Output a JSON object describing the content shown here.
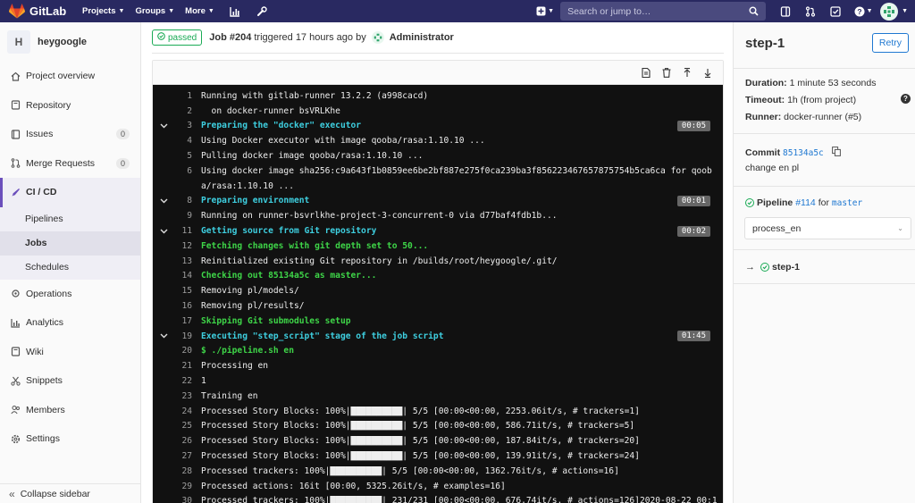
{
  "topbar": {
    "brand": "GitLab",
    "nav": [
      "Projects",
      "Groups",
      "More"
    ],
    "search_placeholder": "Search or jump to…"
  },
  "sidebar": {
    "project_initial": "H",
    "project_name": "heygoogle",
    "items": [
      {
        "label": "Project overview",
        "icon": "home-icon"
      },
      {
        "label": "Repository",
        "icon": "book-icon"
      },
      {
        "label": "Issues",
        "icon": "issues-icon",
        "count": "0"
      },
      {
        "label": "Merge Requests",
        "icon": "merge-request-icon",
        "count": "0"
      }
    ],
    "cicd": {
      "label": "CI / CD",
      "subitems": [
        "Pipelines",
        "Jobs",
        "Schedules"
      ]
    },
    "items_after": [
      {
        "label": "Operations",
        "icon": "cloud-gear-icon"
      },
      {
        "label": "Analytics",
        "icon": "chart-icon"
      },
      {
        "label": "Wiki",
        "icon": "book-icon"
      },
      {
        "label": "Snippets",
        "icon": "scissors-icon"
      },
      {
        "label": "Members",
        "icon": "users-icon"
      },
      {
        "label": "Settings",
        "icon": "gear-icon"
      }
    ],
    "collapse_label": "Collapse sidebar"
  },
  "job": {
    "status": "passed",
    "title": "Job #204",
    "triggered": "triggered 17 hours ago by",
    "user": "Administrator"
  },
  "log": [
    {
      "n": "1",
      "text": "Running with gitlab-runner 13.2.2 (a998cacd)"
    },
    {
      "n": "2",
      "text": "  on docker-runner bsVRLKhe"
    },
    {
      "n": "3",
      "text": "Preparing the \"docker\" executor",
      "type": "hd",
      "time": "00:05"
    },
    {
      "n": "4",
      "text": "Using Docker executor with image qooba/rasa:1.10.10 ..."
    },
    {
      "n": "5",
      "text": "Pulling docker image qooba/rasa:1.10.10 ..."
    },
    {
      "n": "6",
      "text": "Using docker image sha256:c9a643f1b0859ee6be2bf887e275f0ca239ba3f856223467657875754b5ca6ca for qoob"
    },
    {
      "n": "",
      "text": "a/rasa:1.10.10 ..."
    },
    {
      "n": "8",
      "text": "Preparing environment",
      "type": "hd",
      "time": "00:01"
    },
    {
      "n": "9",
      "text": "Running on runner-bsvrlkhe-project-3-concurrent-0 via d77baf4fdb1b..."
    },
    {
      "n": "11",
      "text": "Getting source from Git repository",
      "type": "hd",
      "time": "00:02"
    },
    {
      "n": "12",
      "text": "Fetching changes with git depth set to 50...",
      "type": "gr"
    },
    {
      "n": "13",
      "text": "Reinitialized existing Git repository in /builds/root/heygoogle/.git/"
    },
    {
      "n": "14",
      "text": "Checking out 85134a5c as master...",
      "type": "gr"
    },
    {
      "n": "15",
      "text": "Removing pl/models/"
    },
    {
      "n": "16",
      "text": "Removing pl/results/"
    },
    {
      "n": "17",
      "text": "Skipping Git submodules setup",
      "type": "gr"
    },
    {
      "n": "19",
      "text": "Executing \"step_script\" stage of the job script",
      "type": "hd",
      "time": "01:45"
    },
    {
      "n": "20",
      "text": "$ ./pipeline.sh en",
      "type": "gr"
    },
    {
      "n": "21",
      "text": "Processing en"
    },
    {
      "n": "22",
      "text": "1"
    },
    {
      "n": "23",
      "text": "Training en"
    },
    {
      "n": "24",
      "text": "Processed Story Blocks: 100%|██████████| 5/5 [00:00<00:00, 2253.06it/s, # trackers=1]"
    },
    {
      "n": "25",
      "text": "Processed Story Blocks: 100%|██████████| 5/5 [00:00<00:00, 586.71it/s, # trackers=5]"
    },
    {
      "n": "26",
      "text": "Processed Story Blocks: 100%|██████████| 5/5 [00:00<00:00, 187.84it/s, # trackers=20]"
    },
    {
      "n": "27",
      "text": "Processed Story Blocks: 100%|██████████| 5/5 [00:00<00:00, 139.91it/s, # trackers=24]"
    },
    {
      "n": "28",
      "text": "Processed trackers: 100%|██████████| 5/5 [00:00<00:00, 1362.76it/s, # actions=16]"
    },
    {
      "n": "29",
      "text": "Processed actions: 16it [00:00, 5325.26it/s, # examples=16]"
    },
    {
      "n": "30",
      "text": "Processed trackers: 100%|██████████| 231/231 [00:00<00:00, 676.74it/s, # actions=126]2020-08-22 00:1"
    }
  ],
  "right": {
    "title": "step-1",
    "retry": "Retry",
    "duration_label": "Duration:",
    "duration": "1 minute 53 seconds",
    "timeout_label": "Timeout:",
    "timeout": "1h (from project)",
    "runner_label": "Runner:",
    "runner": "docker-runner (#5)",
    "commit_label": "Commit",
    "commit_sha": "85134a5c",
    "commit_msg": "change en pl",
    "pipeline_label": "Pipeline",
    "pipeline_id": "#114",
    "pipeline_for": "for",
    "pipeline_branch": "master",
    "stage_select": "process_en",
    "current_job": "step-1"
  }
}
